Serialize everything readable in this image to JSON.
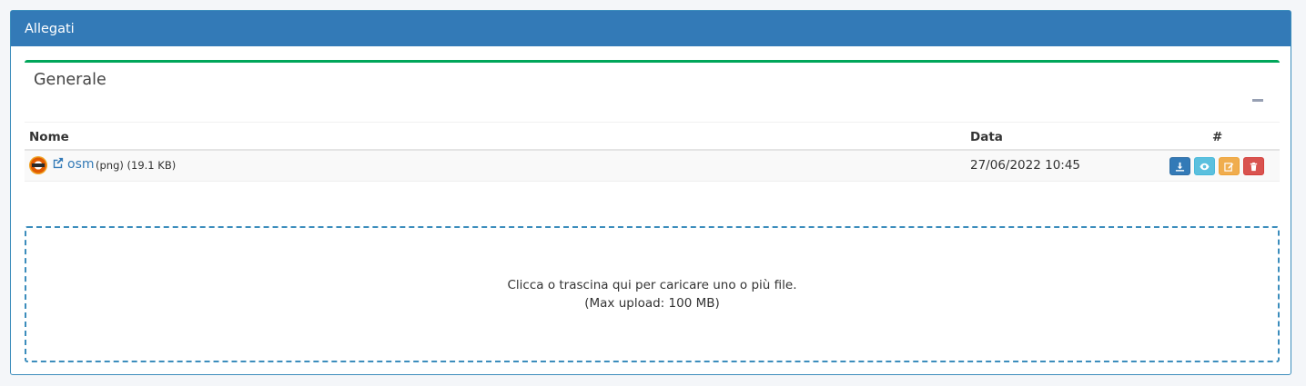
{
  "panel": {
    "title": "Allegati"
  },
  "section": {
    "title": "Generale"
  },
  "table": {
    "headers": {
      "name": "Nome",
      "date": "Data",
      "actions": "#"
    },
    "rows": [
      {
        "name": "osm",
        "type": "(png)",
        "size": "(19.1 KB)",
        "date": "27/06/2022 10:45"
      }
    ]
  },
  "dropzone": {
    "line1": "Clicca o trascina qui per caricare uno o più file.",
    "line2": "(Max upload: 100 MB)"
  },
  "colors": {
    "header": "#337ab7",
    "box_border": "#00a65a",
    "download": "#337ab7",
    "view": "#5bc0de",
    "edit": "#f0ad4e",
    "delete": "#d9534f"
  },
  "icons": [
    "file-thumbnail-icon",
    "external-link-icon",
    "download-icon",
    "eye-icon",
    "edit-icon",
    "trash-icon",
    "minus-icon"
  ]
}
